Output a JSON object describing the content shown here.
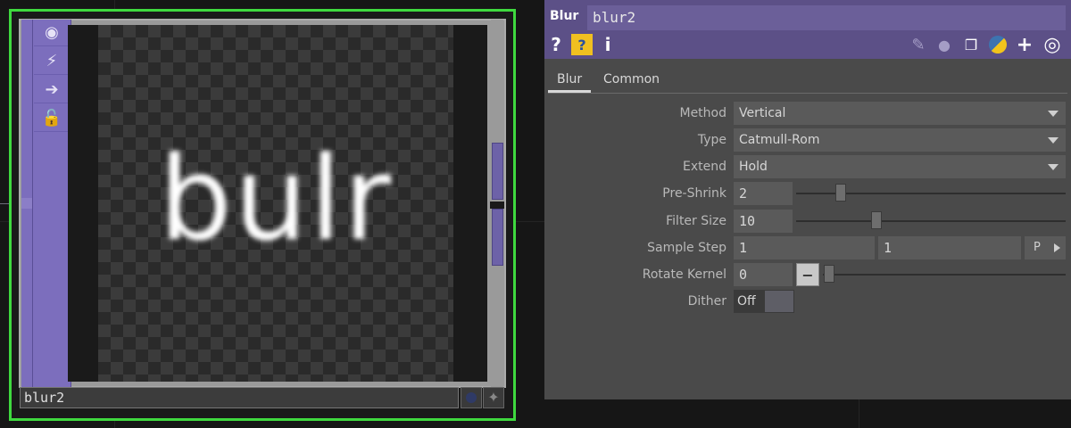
{
  "node": {
    "name": "blur2",
    "preview_text": "bulr",
    "side_icons": [
      "viewer-icon",
      "cooking-icon",
      "export-icon",
      "lock-icon"
    ],
    "bottom_icons": [
      "dot-icon",
      "plus-icon"
    ],
    "selected_color": "#3fd93f",
    "accent_color": "#7c6ebd"
  },
  "panel": {
    "op_type": "Blur",
    "op_name": "blur2",
    "header_icons": {
      "left": [
        "help-icon",
        "python-help-icon",
        "info-icon"
      ],
      "right": [
        "pencil-icon",
        "comment-icon",
        "clone-icon",
        "python-icon",
        "plus-icon",
        "viewer-icon"
      ]
    },
    "tabs": [
      {
        "label": "Blur",
        "active": true
      },
      {
        "label": "Common",
        "active": false
      }
    ],
    "params": {
      "method": {
        "label": "Method",
        "value": "Vertical"
      },
      "type": {
        "label": "Type",
        "value": "Catmull-Rom"
      },
      "extend": {
        "label": "Extend",
        "value": "Hold"
      },
      "preshrink": {
        "label": "Pre-Shrink",
        "value": "2",
        "slider_pos": 0.15
      },
      "filtersize": {
        "label": "Filter Size",
        "value": "10",
        "slider_pos": 0.29
      },
      "samplestep": {
        "label": "Sample Step",
        "value1": "1",
        "value2": "1",
        "button": "P"
      },
      "rotatekernel": {
        "label": "Rotate Kernel",
        "value": "0",
        "button": "−"
      },
      "dither": {
        "label": "Dither",
        "value": "Off"
      }
    },
    "header_color": "#5c5087"
  }
}
